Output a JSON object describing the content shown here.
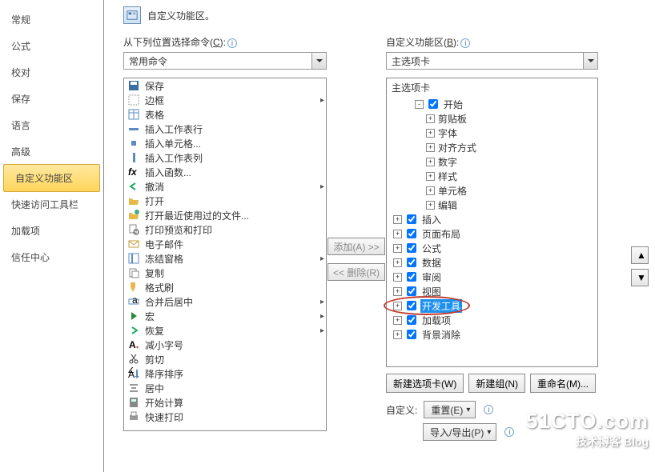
{
  "title": "自定义功能区。",
  "sidebar": {
    "items": [
      {
        "label": "常规"
      },
      {
        "label": "公式"
      },
      {
        "label": "校对"
      },
      {
        "label": "保存"
      },
      {
        "label": "语言"
      },
      {
        "label": "高级"
      },
      {
        "label": "自定义功能区"
      },
      {
        "label": "快速访问工具栏"
      },
      {
        "label": "加载项"
      },
      {
        "label": "信任中心"
      }
    ],
    "selected": 6
  },
  "left": {
    "label_prefix": "从下列位置选择命令(",
    "label_key": "C",
    "label_suffix": "):",
    "select": "常用命令",
    "commands": [
      {
        "icon": "save",
        "name": "保存"
      },
      {
        "icon": "border",
        "name": "边框",
        "sub": "▸"
      },
      {
        "icon": "table",
        "name": "表格"
      },
      {
        "icon": "ins-row",
        "name": "插入工作表行"
      },
      {
        "icon": "ins-cell",
        "name": "插入单元格..."
      },
      {
        "icon": "ins-col",
        "name": "插入工作表列"
      },
      {
        "icon": "fx",
        "name": "插入函数..."
      },
      {
        "icon": "undo",
        "name": "撤消",
        "sub": "▸"
      },
      {
        "icon": "open",
        "name": "打开"
      },
      {
        "icon": "recent",
        "name": "打开最近使用过的文件..."
      },
      {
        "icon": "preview",
        "name": "打印预览和打印"
      },
      {
        "icon": "email",
        "name": "电子邮件"
      },
      {
        "icon": "freeze",
        "name": "冻结窗格",
        "sub": "▸"
      },
      {
        "icon": "copy",
        "name": "复制"
      },
      {
        "icon": "fmt",
        "name": "格式刷"
      },
      {
        "icon": "merge",
        "name": "合并后居中",
        "sub": "▸"
      },
      {
        "icon": "macro",
        "name": "宏",
        "sub": "▸"
      },
      {
        "icon": "redo",
        "name": "恢复",
        "sub": "▸"
      },
      {
        "icon": "small",
        "name": "减小字号"
      },
      {
        "icon": "cut",
        "name": "剪切"
      },
      {
        "icon": "sort",
        "name": "降序排序"
      },
      {
        "icon": "center",
        "name": "居中"
      },
      {
        "icon": "calc",
        "name": "开始计算"
      },
      {
        "icon": "qprint",
        "name": "快速打印"
      }
    ]
  },
  "mid": {
    "add": "添加(A) >>",
    "remove": "<< 删除(R)"
  },
  "right": {
    "label_prefix": "自定义功能区(",
    "label_key": "B",
    "label_suffix": "):",
    "select": "主选项卡",
    "header": "主选项卡",
    "tree": [
      {
        "exp": "-",
        "chk": true,
        "label": "开始",
        "lvl": 2
      },
      {
        "exp": "+",
        "label": "剪贴板",
        "lvl": 3
      },
      {
        "exp": "+",
        "label": "字体",
        "lvl": 3
      },
      {
        "exp": "+",
        "label": "对齐方式",
        "lvl": 3
      },
      {
        "exp": "+",
        "label": "数字",
        "lvl": 3
      },
      {
        "exp": "+",
        "label": "样式",
        "lvl": 3
      },
      {
        "exp": "+",
        "label": "单元格",
        "lvl": 3
      },
      {
        "exp": "+",
        "label": "编辑",
        "lvl": 3
      },
      {
        "exp": "+",
        "chk": true,
        "label": "插入",
        "lvl": 1
      },
      {
        "exp": "+",
        "chk": true,
        "label": "页面布局",
        "lvl": 1
      },
      {
        "exp": "+",
        "chk": true,
        "label": "公式",
        "lvl": 1
      },
      {
        "exp": "+",
        "chk": true,
        "label": "数据",
        "lvl": 1
      },
      {
        "exp": "+",
        "chk": true,
        "label": "审阅",
        "lvl": 1
      },
      {
        "exp": "+",
        "chk": true,
        "label": "视图",
        "lvl": 1
      },
      {
        "exp": "+",
        "chk": true,
        "label": "开发工具",
        "lvl": 1,
        "sel": true,
        "annot": true
      },
      {
        "exp": "+",
        "chk": true,
        "label": "加载项",
        "lvl": 1
      },
      {
        "exp": "+",
        "chk": true,
        "label": "背景消除",
        "lvl": 1
      }
    ],
    "new_tab": "新建选项卡(W)",
    "new_group": "新建组(N)",
    "rename": "重命名(M)...",
    "custom_lbl": "自定义:",
    "reset": "重置(E)",
    "impexp": "导入/导出(P)"
  },
  "arrows": {
    "up": "▲",
    "down": "▼"
  },
  "watermark": {
    "big": "51CTO.com",
    "sm": "技术博客   Blog"
  }
}
